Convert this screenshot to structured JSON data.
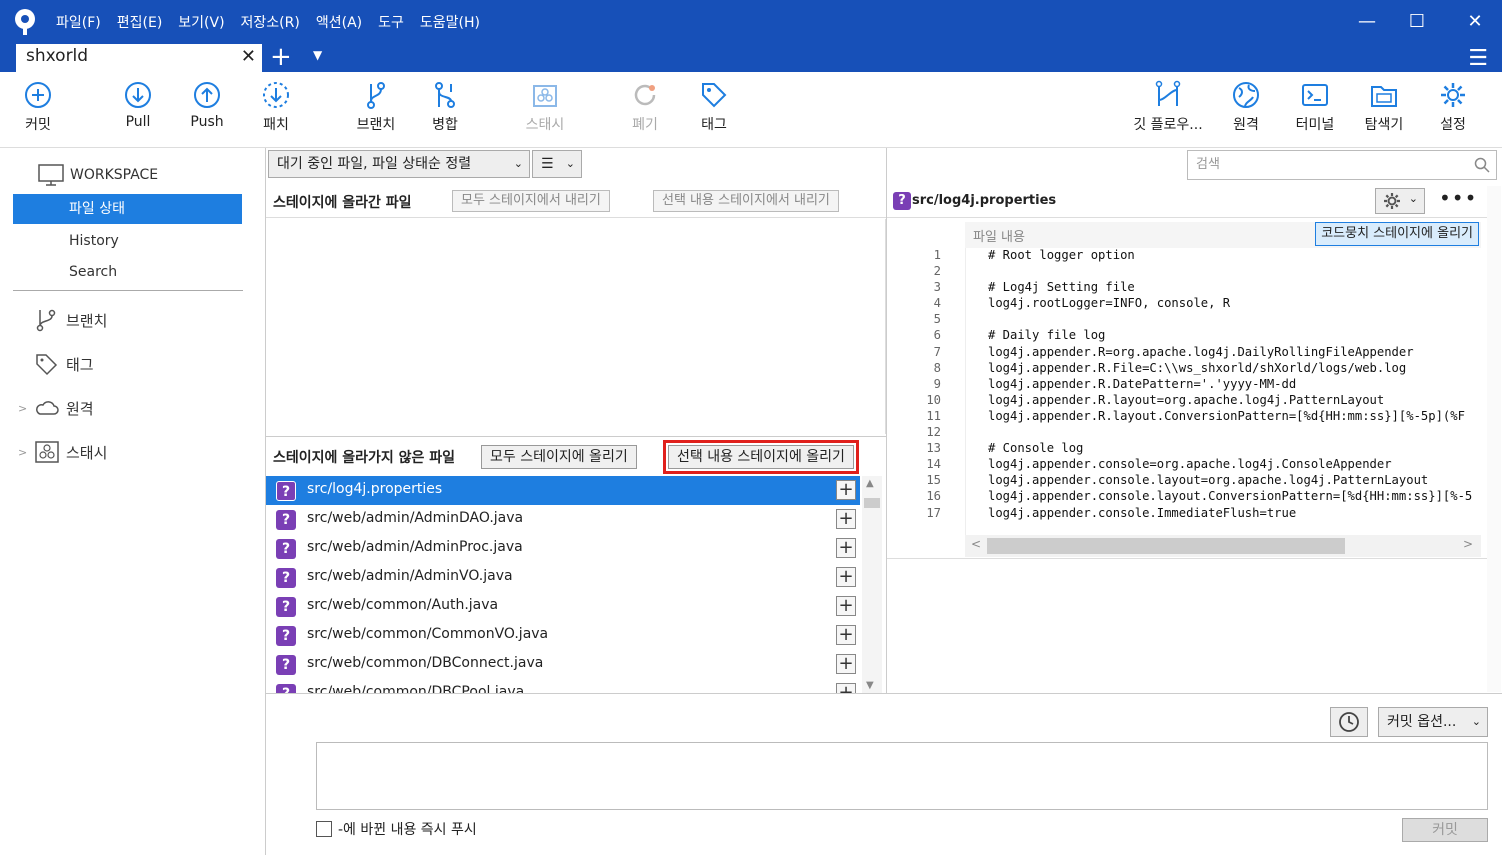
{
  "menu": [
    "파일(F)",
    "편집(E)",
    "보기(V)",
    "저장소(R)",
    "액션(A)",
    "도구",
    "도움말(H)"
  ],
  "tab": {
    "title": "shxorld"
  },
  "toolbar": {
    "commit": "커밋",
    "pull": "Pull",
    "push": "Push",
    "patch": "패치",
    "branch": "브랜치",
    "merge": "병합",
    "stash": "스태시",
    "discard": "폐기",
    "tag": "태그",
    "gitflow": "깃 플로우...",
    "remote": "원격",
    "terminal": "터미널",
    "explorer": "탐색기",
    "settings": "설정"
  },
  "sidebar": {
    "workspace": "WORKSPACE",
    "items": [
      "파일 상태",
      "History",
      "Search"
    ],
    "sections": [
      "브랜치",
      "태그",
      "원격",
      "스태시"
    ]
  },
  "filter": {
    "sort": "대기 중인 파일, 파일 상태순 정렬",
    "view": "☰"
  },
  "staged": {
    "title": "스테이지에 올라간 파일",
    "unstage_all": "모두 스테이지에서 내리기",
    "unstage_selected": "선택 내용 스테이지에서 내리기"
  },
  "unstaged": {
    "title": "스테이지에 올라가지 않은 파일",
    "stage_all": "모두 스테이지에 올리기",
    "stage_selected": "선택 내용 스테이지에 올리기",
    "files": [
      "src/log4j.properties",
      "src/web/admin/AdminDAO.java",
      "src/web/admin/AdminProc.java",
      "src/web/admin/AdminVO.java",
      "src/web/common/Auth.java",
      "src/web/common/CommonVO.java",
      "src/web/common/DBConnect.java",
      "src/web/common/DBCPool.java"
    ]
  },
  "search": {
    "placeholder": "검색"
  },
  "diff": {
    "file": "src/log4j.properties",
    "hunk_label": "파일 내용",
    "hunk_stage": "코드뭉치 스테이지에 올리기",
    "lines": [
      "# Root logger option",
      "",
      "# Log4j Setting file",
      "log4j.rootLogger=INFO, console, R",
      "",
      "# Daily file log",
      "log4j.appender.R=org.apache.log4j.DailyRollingFileAppender",
      "log4j.appender.R.File=C:\\\\ws_shxorld/shXorld/logs/web.log",
      "log4j.appender.R.DatePattern='.'yyyy-MM-dd",
      "log4j.appender.R.layout=org.apache.log4j.PatternLayout",
      "log4j.appender.R.layout.ConversionPattern=[%d{HH:mm:ss}][%-5p](%F",
      "",
      "# Console log",
      "log4j.appender.console=org.apache.log4j.ConsoleAppender",
      "log4j.appender.console.layout=org.apache.log4j.PatternLayout",
      "log4j.appender.console.layout.ConversionPattern=[%d{HH:mm:ss}][%-5",
      "log4j.appender.console.ImmediateFlush=true"
    ]
  },
  "commit": {
    "options": "커밋 옵션...",
    "push_label": "-에 바뀐 내용 즉시 푸시",
    "button": "커밋"
  },
  "colors": {
    "titlebar": "#1750b8",
    "accent": "#1e7ee0",
    "highlight": "#e0201c",
    "unknown_file": "#7a3fb5"
  }
}
